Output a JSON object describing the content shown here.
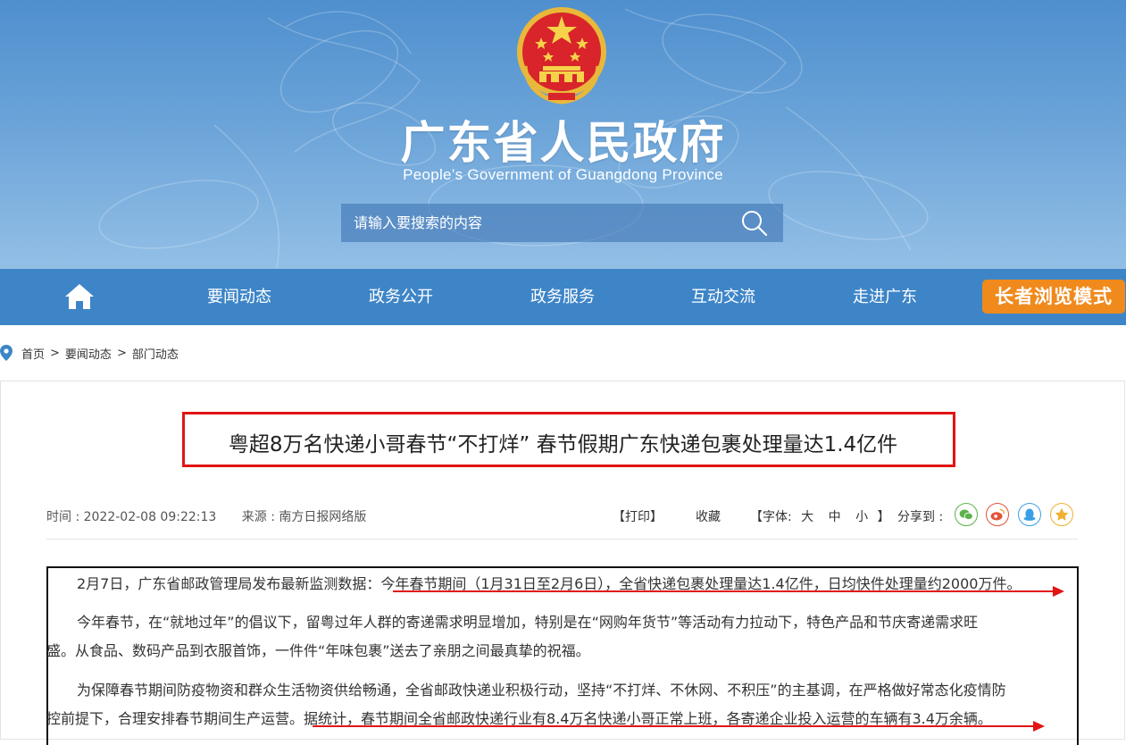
{
  "header": {
    "site_title": "广东省人民政府",
    "site_subtitle": "People’s Government of Guangdong Province",
    "search_placeholder": "请输入要搜索的内容",
    "emblem": "national-emblem",
    "search_icon": "search-icon",
    "colors": {
      "banner": "#5b98d2",
      "nav": "#3e85c8",
      "accent": "#f08a1c"
    }
  },
  "nav": {
    "home_icon": "home-icon",
    "items": [
      "要闻动态",
      "政务公开",
      "政务服务",
      "互动交流",
      "走进广东"
    ],
    "elder_mode": "长者浏览模式"
  },
  "breadcrumb": {
    "icon": "location-pin-icon",
    "items": [
      "首页",
      "要闻动态",
      "部门动态"
    ],
    "separator": ">"
  },
  "article": {
    "title": "粤超8万名快递小哥春节“不打烊” 春节假期广东快递包裹处理量达1.4亿件",
    "time": "时间 : 2022-02-08 09:22:13",
    "source": "来源 : 南方日报网络版",
    "print": "【打印】",
    "favorite": "收藏",
    "font_label": "【字体:",
    "font_large": "大",
    "font_medium": "中",
    "font_small": "小",
    "font_close": "】",
    "share_label": "分享到 :",
    "share_icons": [
      "wechat-icon",
      "weibo-icon",
      "qq-icon",
      "qzone-icon"
    ],
    "highlight_color": "#e21414",
    "paragraphs": {
      "p1_a": "2月7日，广东省邮政管理局发布最新监测数据：",
      "p1_b": "今年春节期间（1月31日至2月6日），全省快递包裹处理量达1.4亿件，日均快件处理量约2000万件。",
      "p2_line1": "今年春节，在“就地过年”的倡议下，留粤过年人群的寄递需求明显增加，特别是在“网购年货节”等活动有力拉动下，特色产品和节庆寄递需求旺",
      "p2_line2": "盛。从食品、数码产品到衣服首饰，一件件“年味包裹”送去了亲朋之间最真挚的祝福。",
      "p3_line1": "为保障春节期间防疫物资和群众生活物资供给畅通，全省邮政快递业积极行动，坚持“不打烊、不休网、不积压”的主基调，在严格做好常态化疫情防",
      "p3_line2_a": "控前提下，合理安排春节期间生产运营。",
      "p3_line2_b": "据统计，春节期间全省邮政快递行业有8.4万名快递小哥正常上班，各寄递企业投入运营的车辆有3.4万余辆。"
    }
  }
}
